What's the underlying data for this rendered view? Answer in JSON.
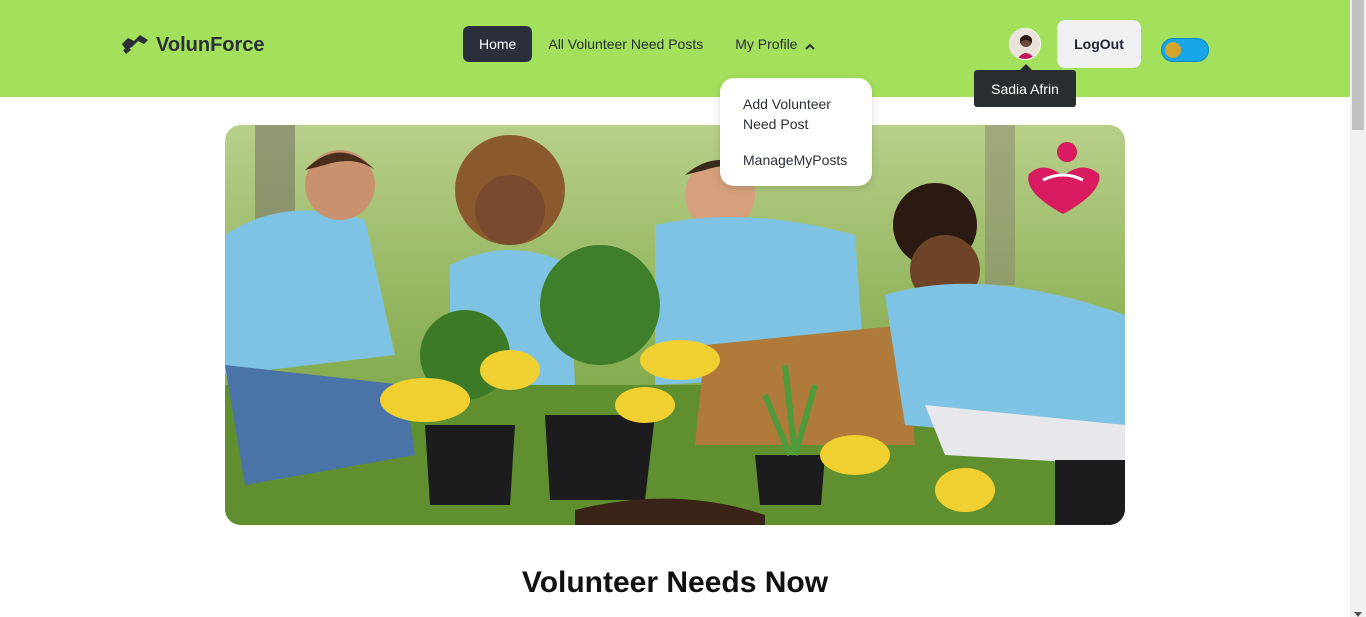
{
  "brand": {
    "name": "VolunForce",
    "logo_icon": "handshake-icon"
  },
  "nav": {
    "home": "Home",
    "all_posts": "All Volunteer Need Posts",
    "my_profile": "My Profile"
  },
  "profile_menu": {
    "add_post": "Add Volunteer Need Post",
    "manage_posts": "ManageMyPosts"
  },
  "user": {
    "display_name": "Sadia Afrin",
    "avatar_icon": "user-avatar-icon"
  },
  "actions": {
    "logout": "LogOut"
  },
  "theme_toggle": {
    "state": "light"
  },
  "hero": {
    "image_alt": "volunteer-banner-image",
    "badge_icon": "heart-hands-icon"
  },
  "sections": {
    "volunteer_needs_title": "Volunteer Needs Now"
  },
  "colors": {
    "navbar": "#a3e05c",
    "active_nav": "#2b2f3b",
    "toggle": "#17a6e8",
    "badge": "#d81b60"
  }
}
